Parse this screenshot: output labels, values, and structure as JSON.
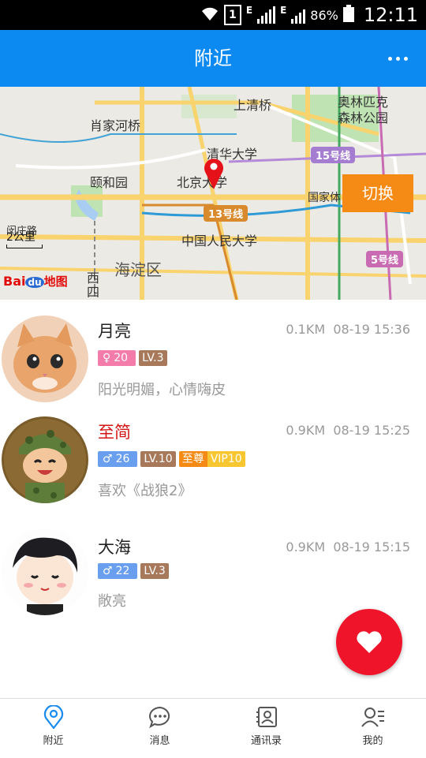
{
  "status": {
    "battery": "86%",
    "time": "12:11",
    "sim": "1",
    "net1": "E",
    "net2": "E"
  },
  "header": {
    "title": "附近"
  },
  "map": {
    "switch_label": "切换",
    "scale": "2公里",
    "logo": {
      "bai": "Bai",
      "du": "du",
      "map": "地图"
    },
    "labels": {
      "shangqingqiao": "上清桥",
      "olympic": "奥林匹克森林公园",
      "xiaojiahe": "肖家河桥",
      "tsinghua": "清华大学",
      "line15": "15号线",
      "summer_palace": "颐和园",
      "pku": "北京大学",
      "guojiati": "国家体",
      "line13": "13号线",
      "renmin": "中国人民大学",
      "road": "闵庄路",
      "haidian": "海淀区",
      "line5": "5号线",
      "xisi": "西四"
    }
  },
  "users": [
    {
      "name": "月亮",
      "distance": "0.1KM",
      "time": "08-19 15:36",
      "gender_symbol": "♀",
      "age": "20",
      "level": "LV.3",
      "bio": "阳光明媚，心情嗨皮"
    },
    {
      "name": "至简",
      "distance": "0.9KM",
      "time": "08-19 15:25",
      "gender_symbol": "♂",
      "age": "26",
      "level": "LV.10",
      "vip_a": "至尊",
      "vip_b": "VIP10",
      "bio": "喜欢《战狼2》"
    },
    {
      "name": "大海",
      "distance": "0.9KM",
      "time": "08-19 15:15",
      "gender_symbol": "♂",
      "age": "22",
      "level": "LV.3",
      "bio": "敞亮"
    }
  ],
  "tabs": [
    {
      "label": "附近",
      "icon": "location-pin-icon"
    },
    {
      "label": "消息",
      "icon": "chat-bubble-icon"
    },
    {
      "label": "通讯录",
      "icon": "contacts-icon"
    },
    {
      "label": "我的",
      "icon": "user-icon"
    }
  ],
  "colors": {
    "primary": "#0c8af2",
    "accent": "#f58a14",
    "fab": "#f0142b",
    "vip_name": "#d51515"
  }
}
